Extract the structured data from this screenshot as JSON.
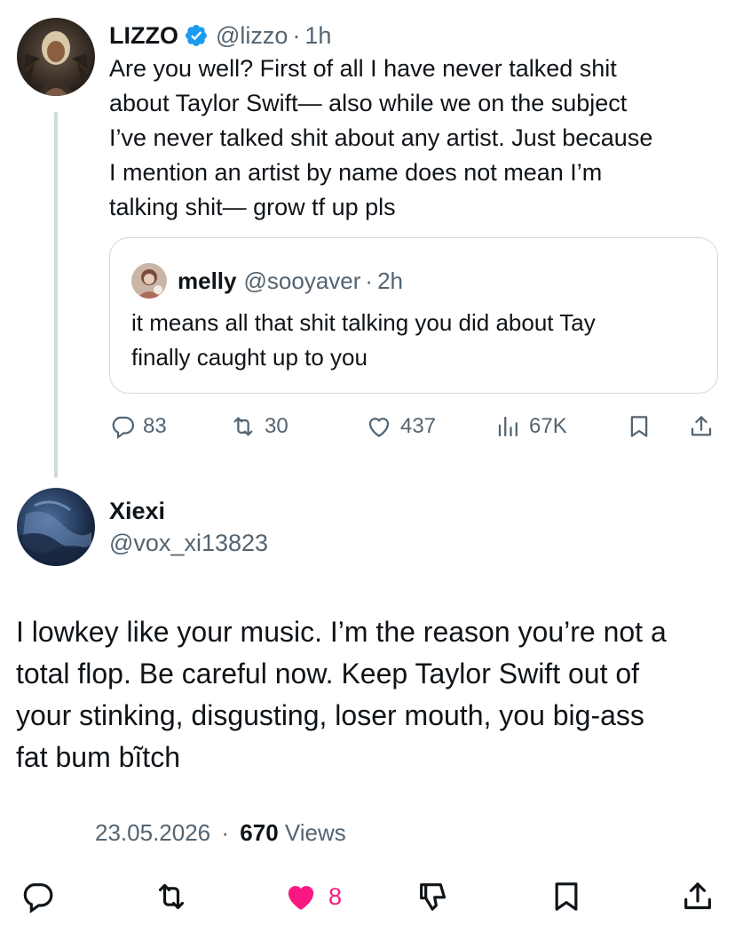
{
  "tweet1": {
    "author_name": "LIZZO",
    "handle": "@lizzo",
    "separator": "·",
    "time": "1h",
    "text": "Are you well? First of all I have never talked shit\nabout Taylor Swift— also while we on the subject\nI’ve never talked shit about any artist. Just because\nI mention an artist by name does not mean I’m\ntalking shit— grow tf up pls",
    "quote": {
      "author_name": "melly",
      "handle": "@sooyaver",
      "separator": "·",
      "time": "2h",
      "text": "it means all that shit talking you did about Tay\nfinally caught up to you"
    },
    "actions": {
      "replies": "83",
      "retweets": "30",
      "likes": "437",
      "views": "67K"
    }
  },
  "tweet2": {
    "author_name": "Xiexi",
    "handle": "@vox_xi13823",
    "text": "I lowkey like your music. I’m the reason you’re not a\ntotal flop. Be careful now. Keep Taylor Swift out of\nyour stinking, disgusting, loser mouth, you big-ass\nfat bum bĩtch",
    "date": "23.05.2026",
    "separator": "·",
    "views_count": "670",
    "views_label": "Views",
    "actions": {
      "likes": "8"
    }
  },
  "colors": {
    "verified": "#1d9bf0",
    "like_active": "#f91880",
    "muted": "#536471",
    "text": "#0f1419",
    "border": "#cfd9de"
  }
}
